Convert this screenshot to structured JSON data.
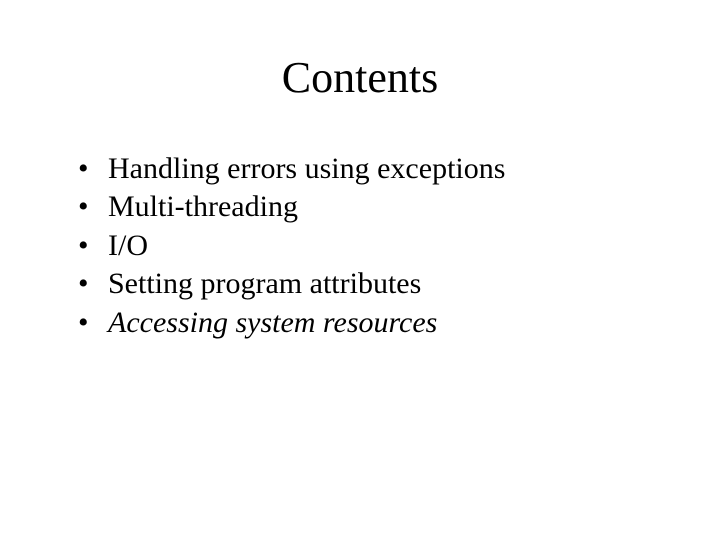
{
  "title": "Contents",
  "items": [
    {
      "text": "Handling errors using exceptions",
      "italic": false
    },
    {
      "text": "Multi-threading",
      "italic": false
    },
    {
      "text": "I/O",
      "italic": false
    },
    {
      "text": "Setting program attributes",
      "italic": false
    },
    {
      "text": "Accessing system resources",
      "italic": true
    }
  ]
}
